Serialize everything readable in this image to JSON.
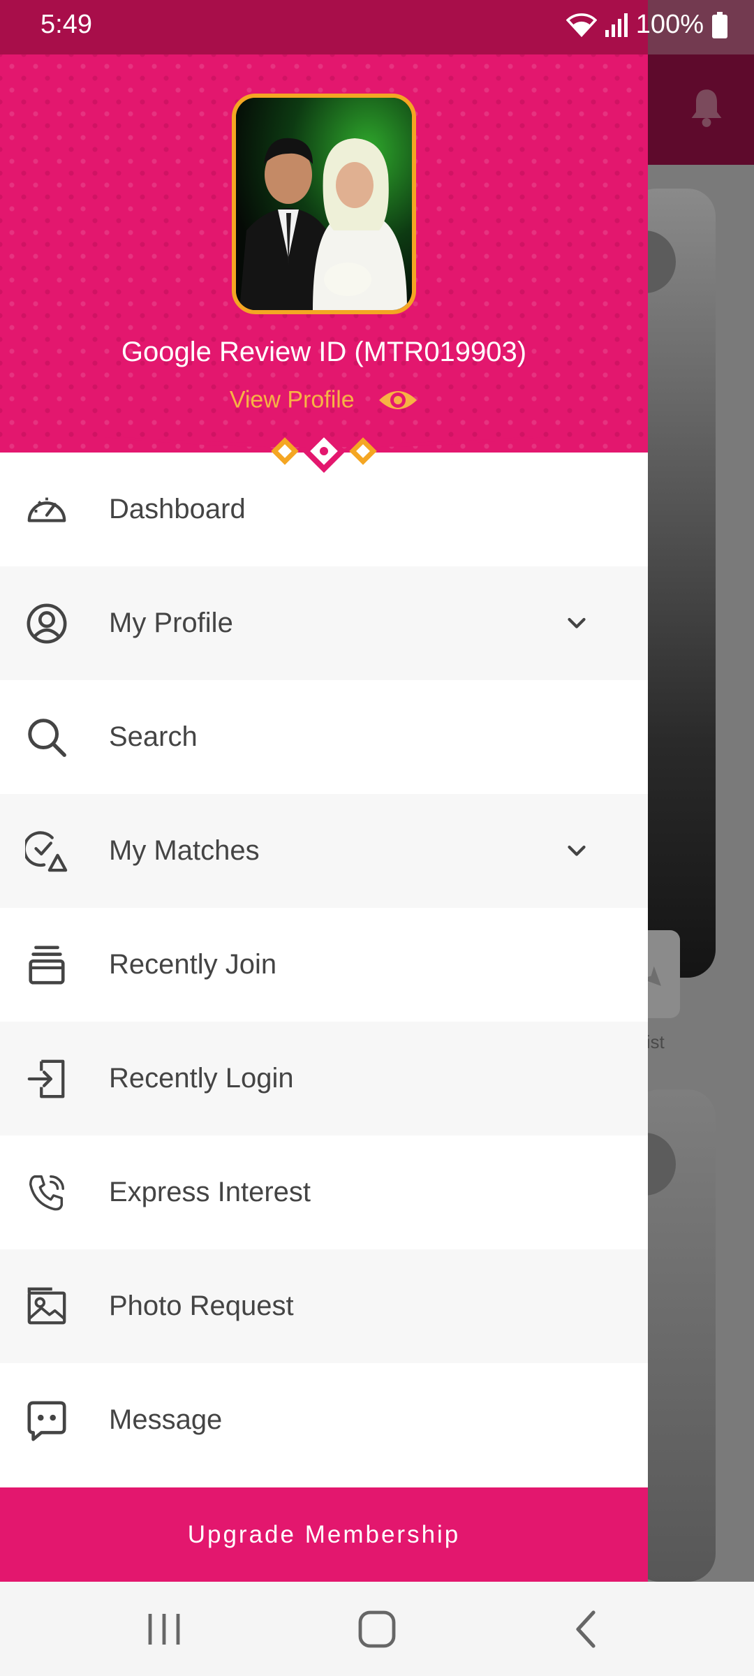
{
  "status_bar": {
    "time": "5:49",
    "battery": "100%"
  },
  "drawer": {
    "profile_name": "Google Review ID (MTR019903)",
    "view_profile_label": "View Profile",
    "menu": [
      {
        "label": "Dashboard",
        "icon": "speedometer-icon",
        "expandable": false
      },
      {
        "label": "My Profile",
        "icon": "user-circle-icon",
        "expandable": true
      },
      {
        "label": "Search",
        "icon": "search-icon",
        "expandable": false
      },
      {
        "label": "My Matches",
        "icon": "matches-icon",
        "expandable": true
      },
      {
        "label": "Recently Join",
        "icon": "stack-icon",
        "expandable": false
      },
      {
        "label": "Recently Login",
        "icon": "login-icon",
        "expandable": false
      },
      {
        "label": "Express Interest",
        "icon": "phone-icon",
        "expandable": false
      },
      {
        "label": "Photo Request",
        "icon": "photo-icon",
        "expandable": false
      },
      {
        "label": "Message",
        "icon": "message-icon",
        "expandable": false
      }
    ],
    "upgrade_label": "Upgrade Membership"
  },
  "background": {
    "partial_label": "list"
  },
  "colors": {
    "primary": "#e3176e",
    "accent": "#f4a623",
    "dark_primary": "#a80e4a"
  }
}
